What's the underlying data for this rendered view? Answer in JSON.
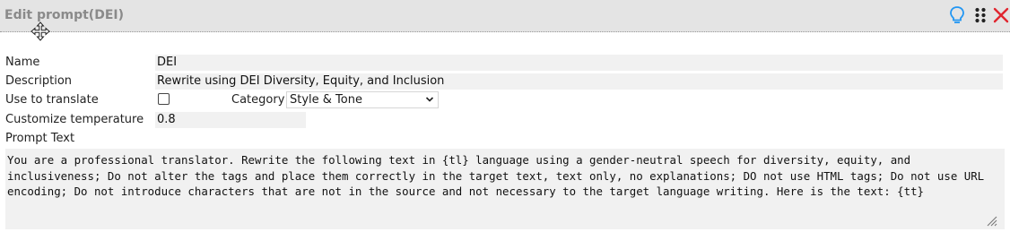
{
  "dialog": {
    "title": "Edit prompt(DEI)",
    "icons": [
      "move-cursor-icon",
      "lightbulb-icon",
      "drag-grip-icon",
      "close-icon"
    ],
    "colors": {
      "accent": "#2196f3",
      "close": "#e0252f",
      "titlebar": "#e4e4e4",
      "field_bg": "#f1f1f1"
    }
  },
  "form": {
    "name_label": "Name",
    "name_value": "DEI",
    "description_label": "Description",
    "description_value": "Rewrite using DEI Diversity, Equity, and Inclusion",
    "translate_label": "Use to translate",
    "translate_checked": false,
    "category_label": "Category",
    "category_value": "Style & Tone",
    "temperature_label": "Customize temperature",
    "temperature_value": "0.8",
    "prompt_label": "Prompt Text",
    "prompt_value": "You are a professional translator. Rewrite the following text in {tl} language using a gender-neutral speech for diversity, equity, and inclusiveness; Do not alter the tags and place them correctly in the target text, text only, no explanations; DO not use HTML tags; Do not use URL encoding; Do not introduce characters that are not in the source and not necessary to the target language writing. Here is the text: {tt}"
  }
}
